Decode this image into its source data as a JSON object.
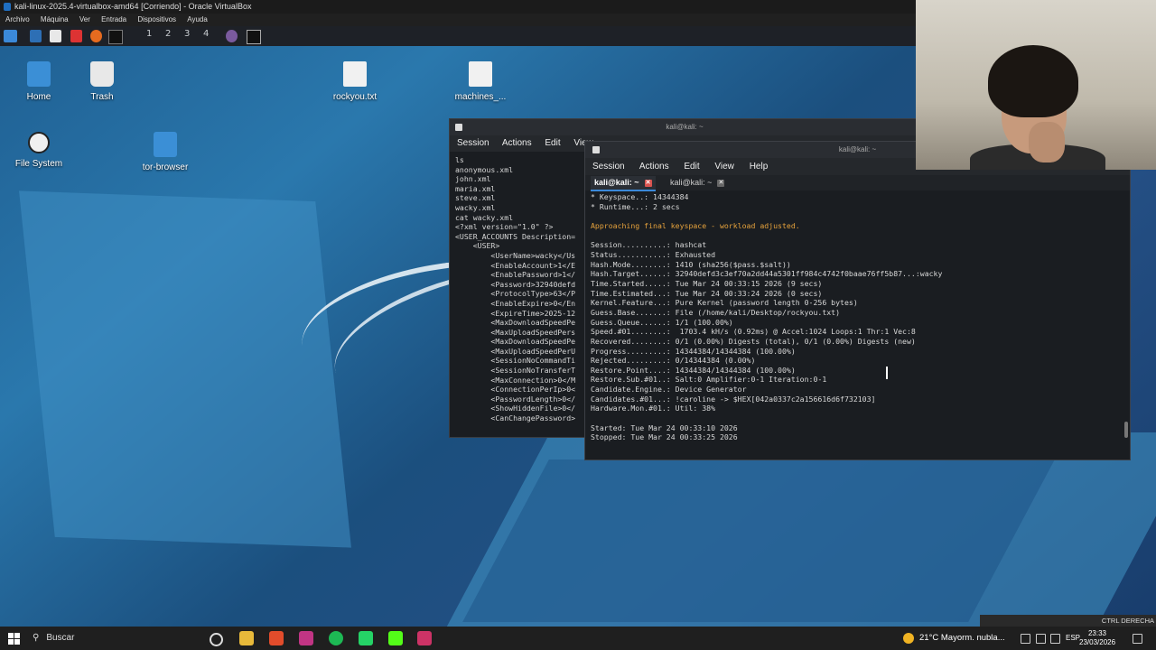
{
  "vbox": {
    "title": "kali-linux-2025.4-virtualbox-amd64 [Corriendo] - Oracle VirtualBox",
    "menu": [
      "Archivo",
      "Máquina",
      "Ver",
      "Entrada",
      "Dispositivos",
      "Ayuda"
    ],
    "status_right": "CTRL DERECHA"
  },
  "kali_panel": {
    "workspaces": [
      "1",
      "2",
      "3",
      "4"
    ]
  },
  "desktop_icons": [
    {
      "label": "Home",
      "icon": "folder-icon"
    },
    {
      "label": "Trash",
      "icon": "trash-icon"
    },
    {
      "label": "rockyou.txt",
      "icon": "file-icon"
    },
    {
      "label": "machines_...",
      "icon": "file-icon"
    },
    {
      "label": "File System",
      "icon": "drive-icon"
    },
    {
      "label": "tor-browser",
      "icon": "folder-icon"
    }
  ],
  "term_back": {
    "title": "kali@kali: ~",
    "menu": [
      "Session",
      "Actions",
      "Edit",
      "View"
    ],
    "lines": [
      "ls",
      "anonymous.xml",
      "john.xml",
      "maria.xml",
      "steve.xml",
      "wacky.xml",
      "cat wacky.xml",
      "<?xml version=\"1.0\" ?>",
      "<USER_ACCOUNTS Description=",
      "    <USER>",
      "        <UserName>wacky</Us",
      "        <EnableAccount>1</E",
      "        <EnablePassword>1</",
      "        <Password>32940defd",
      "        <ProtocolType>63</P",
      "        <EnableExpire>0</En",
      "        <ExpireTime>2025-12",
      "        <MaxDownloadSpeedPe",
      "        <MaxUploadSpeedPers",
      "        <MaxDownloadSpeedPe",
      "        <MaxUploadSpeedPerU",
      "        <SessionNoCommandTi",
      "        <SessionNoTransferT",
      "        <MaxConnection>0</M",
      "        <ConnectionPerIp>0<",
      "        <PasswordLength>0</",
      "        <ShowHiddenFile>0</",
      "        <CanChangePassword>"
    ]
  },
  "term_front": {
    "title": "kali@kali: ~",
    "menu": [
      "Session",
      "Actions",
      "Edit",
      "View",
      "Help"
    ],
    "tabs": [
      {
        "label": "kali@kali: ~",
        "active": true
      },
      {
        "label": "kali@kali: ~",
        "active": false
      }
    ],
    "lines": [
      {
        "text": "* Keyspace..: 14344384",
        "cls": ""
      },
      {
        "text": "* Runtime...: 2 secs",
        "cls": ""
      },
      {
        "text": "",
        "cls": ""
      },
      {
        "text": "Approaching final keyspace - workload adjusted.",
        "cls": "warn"
      },
      {
        "text": "",
        "cls": ""
      },
      {
        "text": "Session..........: hashcat",
        "cls": ""
      },
      {
        "text": "Status...........: Exhausted",
        "cls": ""
      },
      {
        "text": "Hash.Mode........: 1410 (sha256($pass.$salt))",
        "cls": ""
      },
      {
        "text": "Hash.Target......: 32940defd3c3ef70a2dd44a5301ff984c4742f0baae76ff5b87...:wacky",
        "cls": ""
      },
      {
        "text": "Time.Started.....: Tue Mar 24 00:33:15 2026 (9 secs)",
        "cls": ""
      },
      {
        "text": "Time.Estimated...: Tue Mar 24 00:33:24 2026 (0 secs)",
        "cls": ""
      },
      {
        "text": "Kernel.Feature...: Pure Kernel (password length 0-256 bytes)",
        "cls": ""
      },
      {
        "text": "Guess.Base.......: File (/home/kali/Desktop/rockyou.txt)",
        "cls": ""
      },
      {
        "text": "Guess.Queue......: 1/1 (100.00%)",
        "cls": ""
      },
      {
        "text": "Speed.#01........:  1703.4 kH/s (0.92ms) @ Accel:1024 Loops:1 Thr:1 Vec:8",
        "cls": ""
      },
      {
        "text": "Recovered........: 0/1 (0.00%) Digests (total), 0/1 (0.00%) Digests (new)",
        "cls": ""
      },
      {
        "text": "Progress.........: 14344384/14344384 (100.00%)",
        "cls": ""
      },
      {
        "text": "Rejected.........: 0/14344384 (0.00%)",
        "cls": ""
      },
      {
        "text": "Restore.Point....: 14344384/14344384 (100.00%)",
        "cls": ""
      },
      {
        "text": "Restore.Sub.#01..: Salt:0 Amplifier:0-1 Iteration:0-1",
        "cls": ""
      },
      {
        "text": "Candidate.Engine.: Device Generator",
        "cls": ""
      },
      {
        "text": "Candidates.#01...: !caroline -> $HEX[042a0337c2a156616d6f732103]",
        "cls": ""
      },
      {
        "text": "Hardware.Mon.#01.: Util: 38%",
        "cls": ""
      },
      {
        "text": "",
        "cls": ""
      },
      {
        "text": "Started: Tue Mar 24 00:33:10 2026",
        "cls": ""
      },
      {
        "text": "Stopped: Tue Mar 24 00:33:25 2026",
        "cls": ""
      }
    ]
  },
  "taskbar": {
    "search_placeholder": "Buscar",
    "weather": "21°C  Mayorm. nubla...",
    "lang": "ESP",
    "time": "23:33",
    "date": "23/03/2026"
  },
  "colors": {
    "warn": "#e6a23c",
    "tab_accent": "#3b89d9"
  }
}
